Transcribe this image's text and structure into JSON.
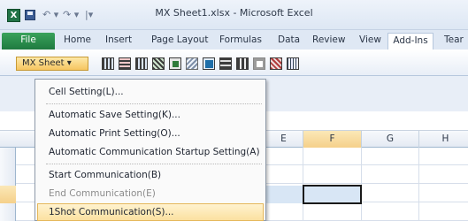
{
  "window": {
    "title": "MX Sheet1.xlsx - Microsoft Excel",
    "app_icon_letter": "X"
  },
  "quick_access": {
    "undo_glyph": "↶ ▾",
    "redo_glyph": "↷ ▾",
    "customize_glyph": "|▾"
  },
  "ribbon": {
    "tabs": [
      "File",
      "Home",
      "Insert",
      "Page Layout",
      "Formulas",
      "Data",
      "Review",
      "View",
      "Add-Ins",
      "Tear"
    ],
    "active_tab": "Add-Ins",
    "mx_sheet_label": "MX Sheet ▾"
  },
  "columns": [
    "E",
    "F",
    "G",
    "H"
  ],
  "menu": {
    "items": [
      {
        "label": "Cell Setting(L)...",
        "enabled": true
      },
      {
        "label": "Automatic Save Setting(K)...",
        "enabled": true
      },
      {
        "label": "Automatic Print Setting(O)...",
        "enabled": true
      },
      {
        "label": "Automatic Communication Startup Setting(A)",
        "enabled": true
      },
      {
        "label": "Start Communication(B)",
        "enabled": true
      },
      {
        "label": "End Communication(E)",
        "enabled": false
      },
      {
        "label": "1Shot Communication(S)...",
        "enabled": true,
        "highlighted": true
      }
    ]
  }
}
